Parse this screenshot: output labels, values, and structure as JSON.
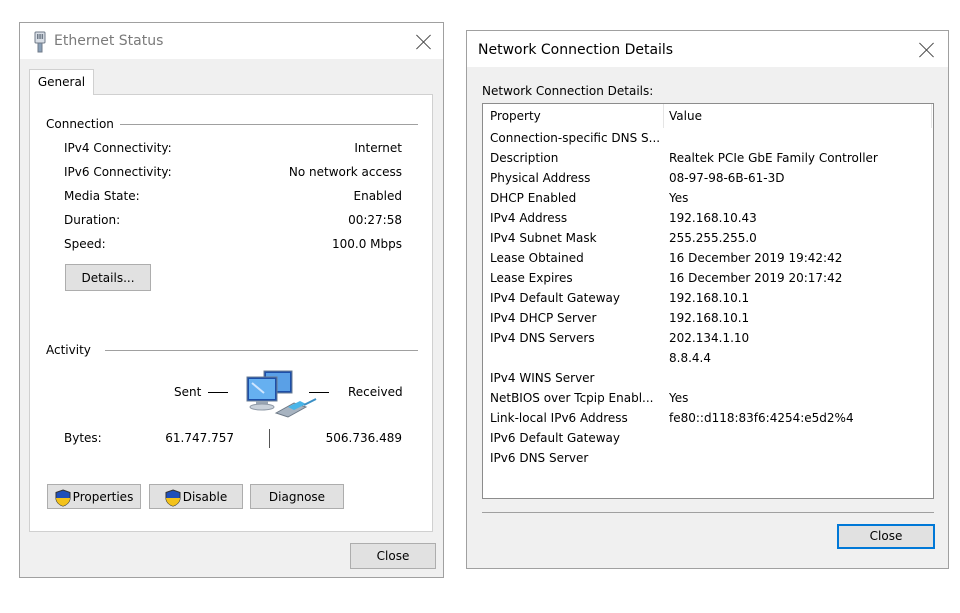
{
  "ethernet_status": {
    "title": "Ethernet Status",
    "tab": "General",
    "connection": {
      "group_label": "Connection",
      "rows": [
        {
          "label": "IPv4 Connectivity:",
          "value": "Internet"
        },
        {
          "label": "IPv6 Connectivity:",
          "value": "No network access"
        },
        {
          "label": "Media State:",
          "value": "Enabled"
        },
        {
          "label": "Duration:",
          "value": "00:27:58"
        },
        {
          "label": "Speed:",
          "value": "100.0 Mbps"
        }
      ],
      "details_button": "Details..."
    },
    "activity": {
      "group_label": "Activity",
      "sent_label": "Sent",
      "received_label": "Received",
      "bytes_label": "Bytes:",
      "bytes_sent": "61.747.757",
      "bytes_received": "506.736.489"
    },
    "buttons": {
      "properties": "Properties",
      "disable": "Disable",
      "diagnose": "Diagnose",
      "close": "Close"
    }
  },
  "network_details": {
    "title": "Network Connection Details",
    "caption": "Network Connection Details:",
    "columns": {
      "property": "Property",
      "value": "Value"
    },
    "rows": [
      {
        "property": "Connection-specific DNS S...",
        "value": ""
      },
      {
        "property": "Description",
        "value": "Realtek PCIe GbE Family Controller"
      },
      {
        "property": "Physical Address",
        "value": "08-97-98-6B-61-3D"
      },
      {
        "property": "DHCP Enabled",
        "value": "Yes"
      },
      {
        "property": "IPv4 Address",
        "value": "192.168.10.43"
      },
      {
        "property": "IPv4 Subnet Mask",
        "value": "255.255.255.0"
      },
      {
        "property": "Lease Obtained",
        "value": "16 December 2019 19:42:42"
      },
      {
        "property": "Lease Expires",
        "value": "16 December 2019 20:17:42"
      },
      {
        "property": "IPv4 Default Gateway",
        "value": "192.168.10.1"
      },
      {
        "property": "IPv4 DHCP Server",
        "value": "192.168.10.1"
      },
      {
        "property": "IPv4 DNS Servers",
        "value": "202.134.1.10"
      },
      {
        "property": "",
        "value": "8.8.4.4"
      },
      {
        "property": "IPv4 WINS Server",
        "value": ""
      },
      {
        "property": "NetBIOS over Tcpip Enabl...",
        "value": "Yes"
      },
      {
        "property": "Link-local IPv6 Address",
        "value": "fe80::d118:83f6:4254:e5d2%4"
      },
      {
        "property": "IPv6 Default Gateway",
        "value": ""
      },
      {
        "property": "IPv6 DNS Server",
        "value": ""
      }
    ],
    "close_button": "Close"
  },
  "icons": [
    "ethernet-adapter-icon",
    "close-icon",
    "network-computers-icon",
    "uac-shield-icon"
  ],
  "colors": {
    "window_bg": "#f0f0f0",
    "button_bg": "#e1e1e1",
    "accent_border": "#0078d7"
  }
}
